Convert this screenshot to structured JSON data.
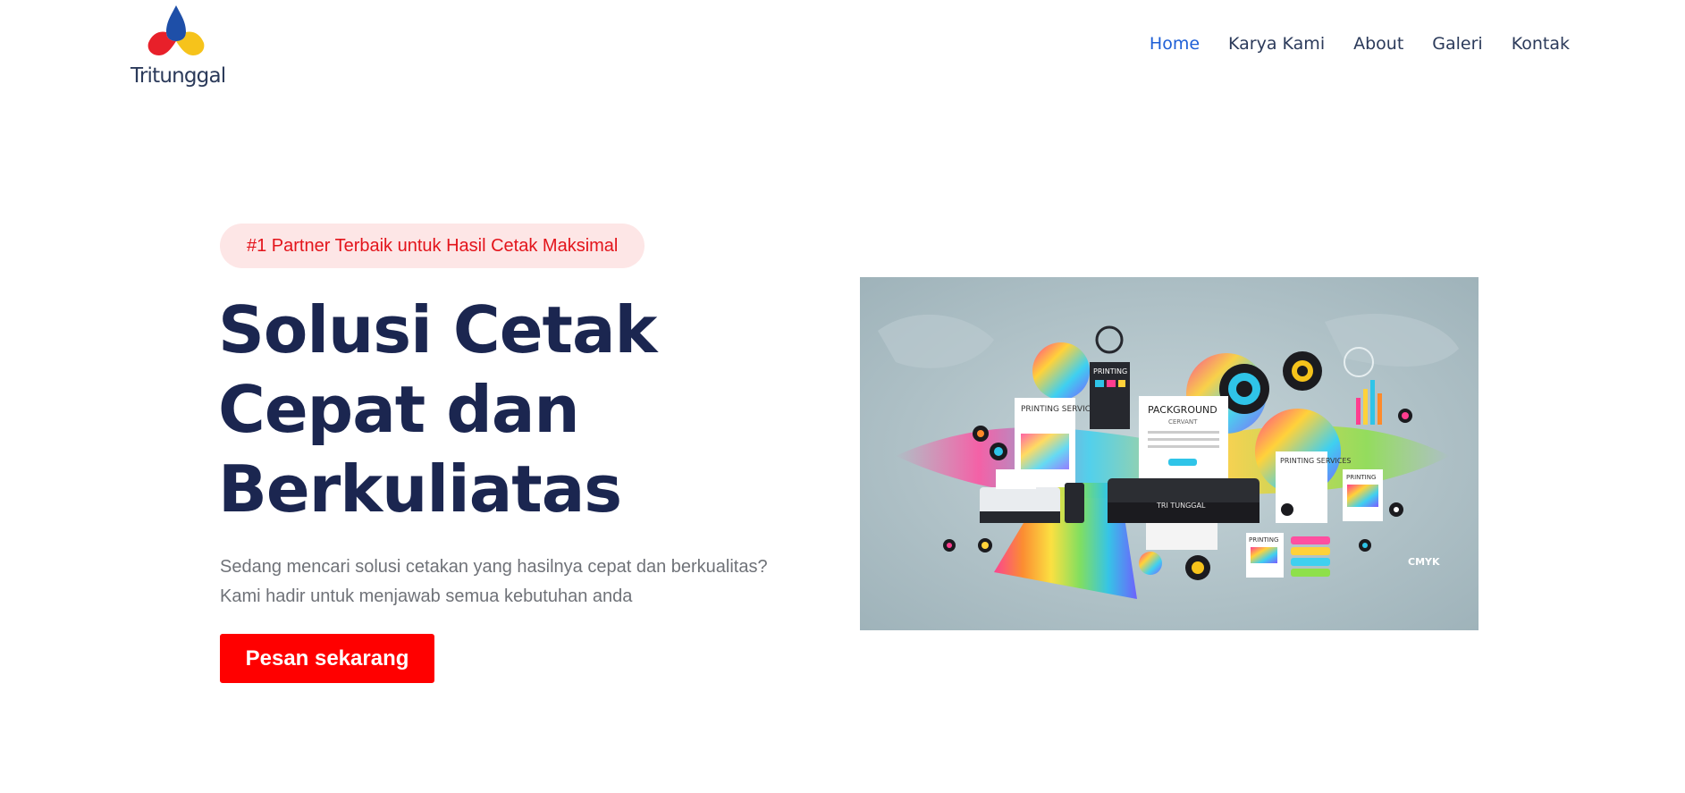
{
  "header": {
    "logo_text": "Tritunggal",
    "logo_icon": "trinity-logo-icon",
    "nav": [
      {
        "label": "Home",
        "active": true
      },
      {
        "label": "Karya Kami",
        "active": false
      },
      {
        "label": "About",
        "active": false
      },
      {
        "label": "Galeri",
        "active": false
      },
      {
        "label": "Kontak",
        "active": false
      }
    ]
  },
  "hero": {
    "badge": "#1 Partner Terbaik untuk Hasil Cetak Maksimal",
    "title_line1": "Solusi Cetak",
    "title_line2": "Cepat dan",
    "title_line3": "Berkuliatas",
    "desc_line1": "Sedang mencari solusi cetakan yang hasilnya cepat dan berkualitas?",
    "desc_line2": "Kami hadir untuk menjawab semua kebutuhan anda",
    "cta_label": "Pesan sekarang",
    "image": {
      "label_printing_1": "PRINTING",
      "label_printing_services_1": "PRINTING SERVICES",
      "label_packground": "PACKGROUND",
      "label_cervant": "CERVANT",
      "label_printing_services_2": "PRINTING SERVICES",
      "label_printing_2": "PRINTING",
      "label_printing_3": "PRINTING",
      "label_printer": "TRI TUNGGAL",
      "label_cmyk": "CMYK"
    }
  },
  "colors": {
    "accent_blue": "#1e5fd6",
    "brand_red": "#ff0000",
    "title_navy": "#1b2650",
    "badge_bg": "#fde6e6"
  }
}
